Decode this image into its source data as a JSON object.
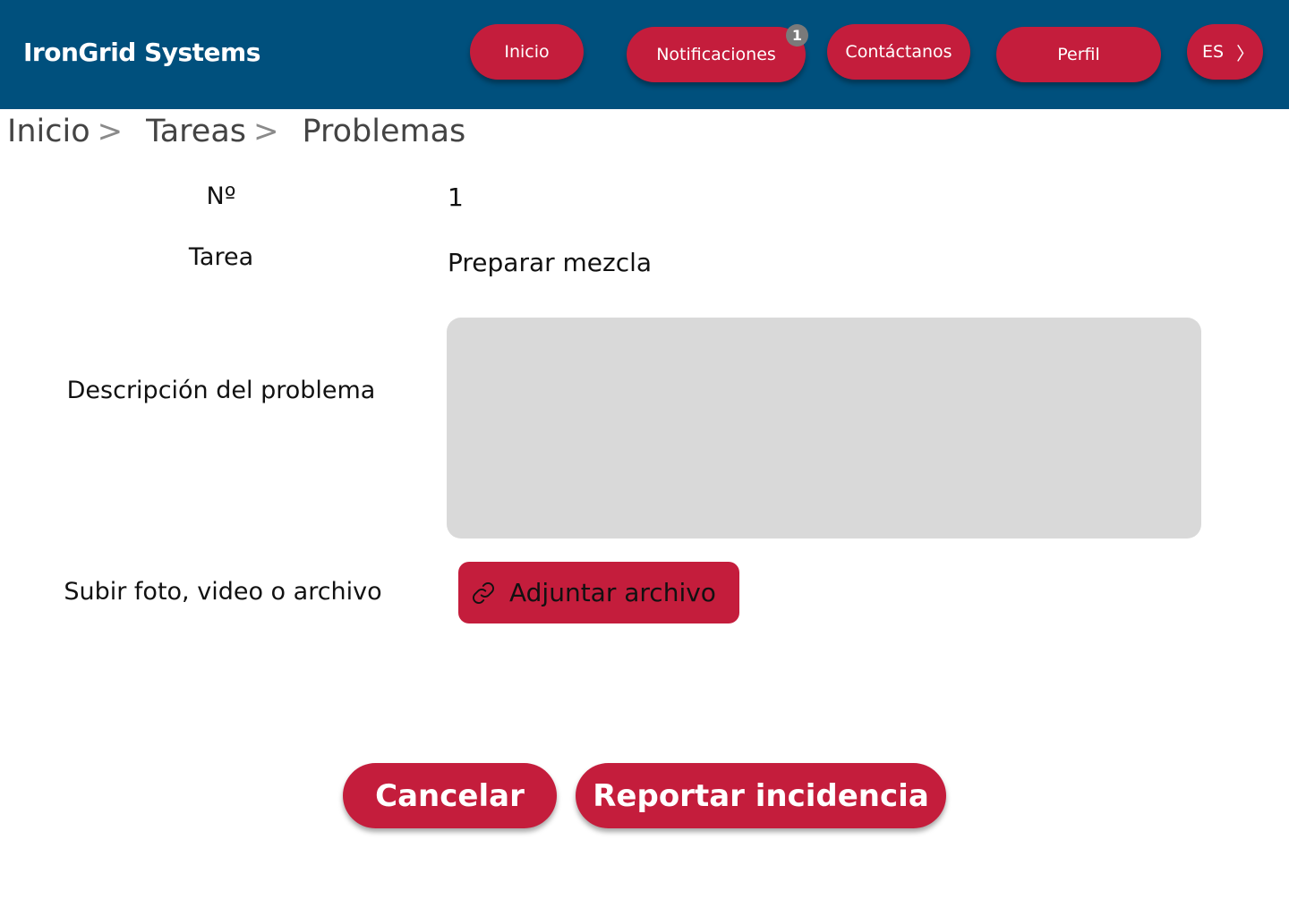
{
  "header": {
    "brand": "IronGrid Systems",
    "nav": {
      "inicio": "Inicio",
      "notificaciones": "Notificaciones",
      "notificaciones_count": "1",
      "contactanos": "Contáctanos",
      "perfil": "Perfil",
      "language": "ES",
      "language_chevron": "〉"
    },
    "colors": {
      "bar": "#00507d",
      "button": "#c41d3c",
      "badge": "#7a7a7a"
    }
  },
  "breadcrumb": {
    "items": [
      "Inicio",
      "Tareas",
      "Problemas"
    ],
    "separator": ">"
  },
  "form": {
    "number_label": "Nº",
    "number_value": "1",
    "task_label": "Tarea",
    "task_value": "Preparar mezcla",
    "description_label": "Descripción del problema",
    "description_value": "",
    "upload_label": "Subir foto, video o archivo",
    "attach_button": "Adjuntar archivo",
    "attach_icon": "link-icon"
  },
  "actions": {
    "cancel": "Cancelar",
    "report": "Reportar incidencia"
  }
}
